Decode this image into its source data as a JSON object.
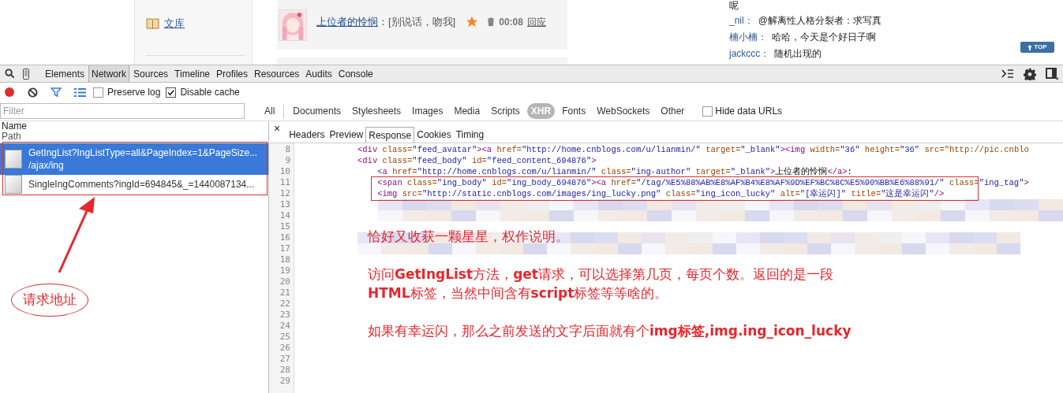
{
  "page": {
    "sidebar_items": [
      {
        "label": "文库"
      }
    ],
    "post": {
      "author": "上位者的怜悯",
      "text": "：[别说话，吻我]",
      "time": "00:08",
      "reply": "回应"
    },
    "comments_tail": "呢",
    "comments": [
      {
        "user": "_nil：",
        "text": "@解离性人格分裂者：求写真"
      },
      {
        "user": "楠小楠：",
        "text": "哈哈，今天是个好日子啊"
      },
      {
        "user": "jackccc：",
        "text": "随机出现的"
      }
    ],
    "top_button": "TOP"
  },
  "devtools": {
    "tabs": [
      {
        "label": "Elements",
        "selected": false
      },
      {
        "label": "Network",
        "selected": true
      },
      {
        "label": "Sources",
        "selected": false
      },
      {
        "label": "Timeline",
        "selected": false
      },
      {
        "label": "Profiles",
        "selected": false
      },
      {
        "label": "Resources",
        "selected": false
      },
      {
        "label": "Audits",
        "selected": false
      },
      {
        "label": "Console",
        "selected": false
      }
    ],
    "options": [
      {
        "label": "Preserve log",
        "checked": false
      },
      {
        "label": "Disable cache",
        "checked": true
      }
    ],
    "filter": {
      "placeholder": "Filter"
    },
    "type_filters": [
      {
        "label": "All",
        "selected": false
      },
      {
        "label": "Documents",
        "selected": false
      },
      {
        "label": "Stylesheets",
        "selected": false
      },
      {
        "label": "Images",
        "selected": false
      },
      {
        "label": "Media",
        "selected": false
      },
      {
        "label": "Scripts",
        "selected": false
      },
      {
        "label": "XHR",
        "selected": true
      },
      {
        "label": "Fonts",
        "selected": false
      },
      {
        "label": "WebSockets",
        "selected": false
      },
      {
        "label": "Other",
        "selected": false
      }
    ],
    "hide_data_urls": {
      "label": "Hide data URLs",
      "checked": false
    },
    "requests_header": {
      "name": "Name",
      "path": "Path"
    },
    "requests": [
      {
        "name": "GetIngList?IngListType=all&PageIndex=1&PageSize...",
        "path": "/ajax/ing",
        "selected": true
      },
      {
        "name": "SingleIngComments?ingId=694845&_=1440087134...",
        "selected": false
      }
    ],
    "close": "×",
    "detail_tabs": [
      {
        "label": "Headers",
        "selected": false
      },
      {
        "label": "Preview",
        "selected": false
      },
      {
        "label": "Response",
        "selected": true
      },
      {
        "label": "Cookies",
        "selected": false
      },
      {
        "label": "Timing",
        "selected": false
      }
    ],
    "line_numbers": [
      "8",
      "9",
      "10",
      "11",
      "12",
      "13",
      "14",
      "15",
      "16",
      "17",
      "18",
      "19",
      "20",
      "21",
      "22",
      "23",
      "24",
      "25",
      "26",
      "27",
      "28",
      "29"
    ],
    "code_lines": [
      "<div class=\"feed_avatar\"><a href=\"http://home.cnblogs.com/u/lianmin/\" target=\"_blank\"><img width=\"36\" height=\"36\" src=\"http://pic.cnblo",
      "<div class=\"feed_body\" id=\"feed_content_694876\">",
      "    <a href=\"http://home.cnblogs.com/u/lianmin/\" class=\"ing-author\" target=\"_blank\">上位者的怜悯</a>:",
      "    <span class=\"ing_body\" id=\"ing_body_694876\"><a href=\"/tag/%E5%88%AB%E8%AF%B4%E8%AF%9D%EF%BC%8C%E5%90%BB%E6%88%91/\" class=\"ing_tag\">",
      "    <img src=\"http://static.cnblogs.com/images/ing_lucky.png\" class=\"ing_icon_lucky\" alt=\"[幸运闪]\" title=\"这是幸运闪\"/>"
    ]
  },
  "annotations": {
    "callout": "请求地址",
    "notes": [
      "恰好又收获一颗星星，权作说明。",
      "访问**GetIngList**方法，**get**请求，可以选择第几页，每页个数。返回的是一段\n**HTML**标签，当然中间含有**script**标签等等啥的。",
      "如果有幸运闪，那么之前发送的文字后面就有个**img标签,img.ing_icon_lucky**"
    ]
  }
}
